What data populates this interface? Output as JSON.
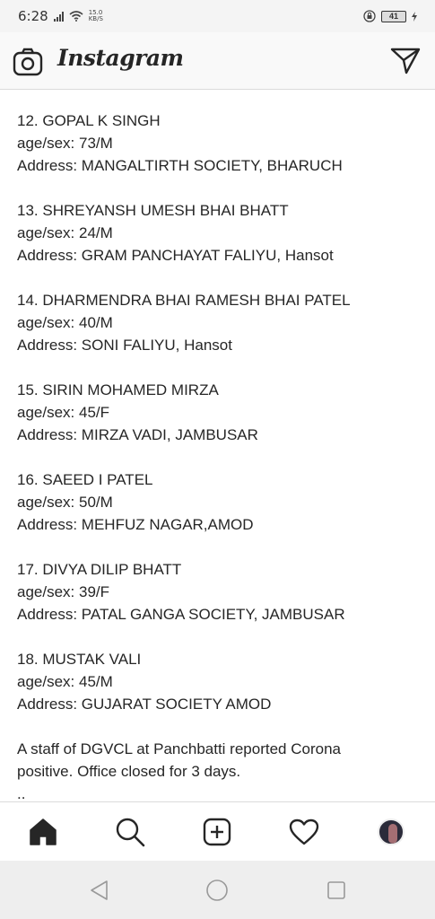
{
  "status_bar": {
    "time": "6:28",
    "net_speed_value": "15.0",
    "net_speed_unit": "KB/S",
    "battery": "41"
  },
  "header": {
    "brand": "Instagram",
    "camera_icon": "camera-icon",
    "direct_icon": "paper-plane-icon"
  },
  "entries": [
    {
      "name": "12. GOPAL K SINGH",
      "age_sex": "age/sex: 73/M",
      "address": "Address: MANGALTIRTH SOCIETY, BHARUCH"
    },
    {
      "name": "13. SHREYANSH UMESH BHAI BHATT",
      "age_sex": "age/sex: 24/M",
      "address": "Address: GRAM PANCHAYAT FALIYU, Hansot"
    },
    {
      "name": "14. DHARMENDRA BHAI RAMESH BHAI PATEL",
      "age_sex": "age/sex: 40/M",
      "address": "Address: SONI FALIYU, Hansot"
    },
    {
      "name": "15. SIRIN MOHAMED MIRZA",
      "age_sex": "age/sex: 45/F",
      "address": "Address: MIRZA VADI, JAMBUSAR"
    },
    {
      "name": "16. SAEED I PATEL",
      "age_sex": "age/sex: 50/M",
      "address": "Address: MEHFUZ NAGAR,AMOD"
    },
    {
      "name": "17. DIVYA DILIP BHATT",
      "age_sex": "age/sex: 39/F",
      "address": "Address: PATAL GANGA SOCIETY, JAMBUSAR"
    },
    {
      "name": "18. MUSTAK VALI",
      "age_sex": "age/sex: 45/M",
      "address": "Address: GUJARAT SOCIETY AMOD"
    }
  ],
  "note": {
    "line1": "A staff of DGVCL at Panchbatti reported Corona",
    "line2": "positive. Office closed for 3 days.",
    "ellipsis": ".."
  },
  "bottom_nav": {
    "items": [
      "home-icon",
      "search-icon",
      "add-post-icon",
      "heart-icon",
      "profile-avatar"
    ]
  },
  "system_nav": {
    "items": [
      "back-icon",
      "home-circle-icon",
      "recents-icon"
    ]
  }
}
